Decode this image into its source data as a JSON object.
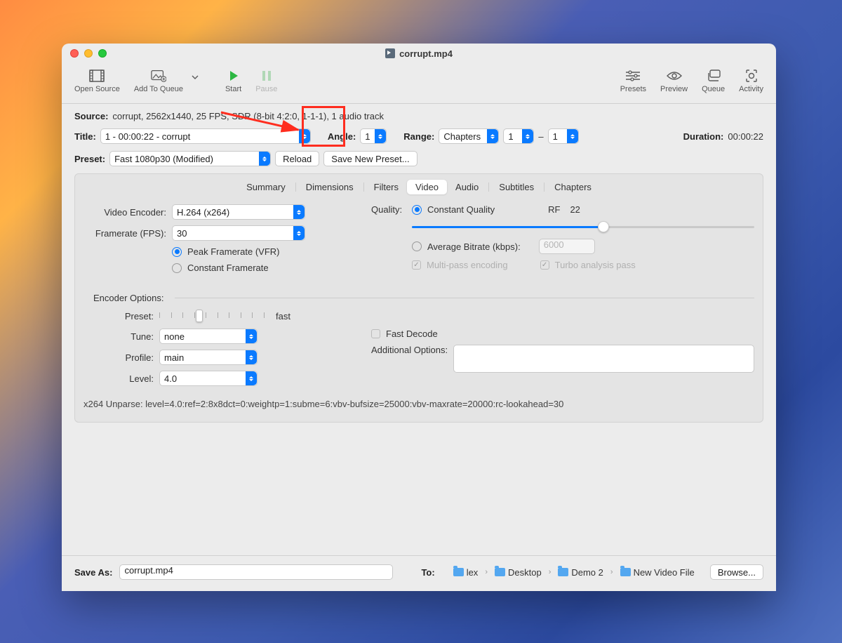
{
  "window": {
    "title": "corrupt.mp4"
  },
  "toolbar": {
    "open_source": "Open Source",
    "add_to_queue": "Add To Queue",
    "start": "Start",
    "pause": "Pause",
    "presets": "Presets",
    "preview": "Preview",
    "queue": "Queue",
    "activity": "Activity"
  },
  "source": {
    "label": "Source:",
    "value": "corrupt, 2562x1440, 25 FPS, SDR (8-bit 4:2:0, 1-1-1), 1 audio track"
  },
  "title_row": {
    "label": "Title:",
    "value": "1 - 00:00:22 - corrupt",
    "angle_label": "Angle:",
    "angle_value": "1",
    "range_label": "Range:",
    "range_value": "Chapters",
    "range_from": "1",
    "range_sep": "–",
    "range_to": "1",
    "duration_label": "Duration:",
    "duration_value": "00:00:22"
  },
  "preset_row": {
    "label": "Preset:",
    "value": "Fast 1080p30 (Modified)",
    "reload": "Reload",
    "save_new": "Save New Preset..."
  },
  "tabs": {
    "summary": "Summary",
    "dimensions": "Dimensions",
    "filters": "Filters",
    "video": "Video",
    "audio": "Audio",
    "subtitles": "Subtitles",
    "chapters": "Chapters"
  },
  "video_tab": {
    "encoder_label": "Video Encoder:",
    "encoder_value": "H.264 (x264)",
    "fps_label": "Framerate (FPS):",
    "fps_value": "30",
    "peak_framerate": "Peak Framerate (VFR)",
    "constant_framerate": "Constant Framerate",
    "quality_label": "Quality:",
    "constant_quality": "Constant Quality",
    "rf_label": "RF",
    "rf_value": "22",
    "avg_bitrate": "Average Bitrate (kbps):",
    "bitrate_value": "6000",
    "multipass": "Multi-pass encoding",
    "turbo": "Turbo analysis pass",
    "encoder_options": "Encoder Options:",
    "enc_preset_label": "Preset:",
    "enc_preset_value": "fast",
    "tune_label": "Tune:",
    "tune_value": "none",
    "fast_decode": "Fast Decode",
    "profile_label": "Profile:",
    "profile_value": "main",
    "additional_label": "Additional Options:",
    "level_label": "Level:",
    "level_value": "4.0",
    "unparse": "x264 Unparse: level=4.0:ref=2:8x8dct=0:weightp=1:subme=6:vbv-bufsize=25000:vbv-maxrate=20000:rc-lookahead=30"
  },
  "footer": {
    "save_as_label": "Save As:",
    "save_as_value": "corrupt.mp4",
    "to_label": "To:",
    "path": [
      "lex",
      "Desktop",
      "Demo 2",
      "New Video File"
    ],
    "browse": "Browse..."
  },
  "annotation": {
    "highlights_start_button": true
  }
}
